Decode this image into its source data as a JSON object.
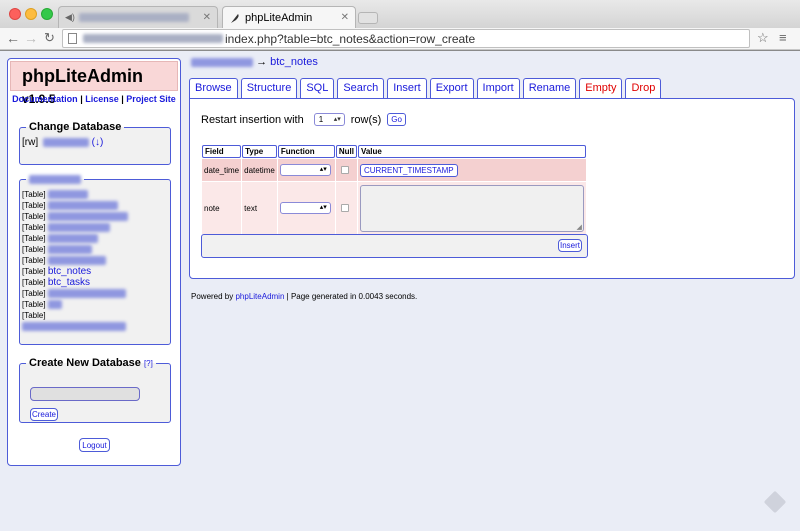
{
  "browser": {
    "tab_active_title": "phpLiteAdmin",
    "address_suffix": "index.php?table=btc_notes&action=row_create"
  },
  "app": {
    "name": "phpLiteAdmin",
    "version": "v1.9.5",
    "link_documentation": "Documentation",
    "link_license": "License",
    "link_project_site": "Project Site",
    "separator": " | "
  },
  "change_database": {
    "legend": "Change Database",
    "prefix": "[rw]",
    "suffix": "(↓)"
  },
  "tables": {
    "prefix": "[Table]",
    "named": [
      "btc_notes",
      "btc_tasks"
    ]
  },
  "create_database": {
    "legend": "Create New Database",
    "help": "[?]",
    "button": "Create"
  },
  "logout_label": "Logout",
  "breadcrumb": {
    "arrow": "→",
    "table": "btc_notes"
  },
  "tabs": [
    "Browse",
    "Structure",
    "SQL",
    "Search",
    "Insert",
    "Export",
    "Import",
    "Rename",
    "Empty",
    "Drop"
  ],
  "insert_form": {
    "restart_label": "Restart insertion with",
    "rows_value": "1",
    "rows_label": "row(s)",
    "go_button": "Go",
    "headers": {
      "field": "Field",
      "type": "Type",
      "function": "Function",
      "null": "Null",
      "value": "Value"
    },
    "rows": [
      {
        "field": "date_time",
        "type": "datetime",
        "value_button": "CURRENT_TIMESTAMP"
      },
      {
        "field": "note",
        "type": "text"
      }
    ],
    "insert_button": "Insert"
  },
  "footer": {
    "powered_by": "Powered by",
    "product": "phpLiteAdmin",
    "generated": "| Page generated in 0.0043 seconds."
  }
}
